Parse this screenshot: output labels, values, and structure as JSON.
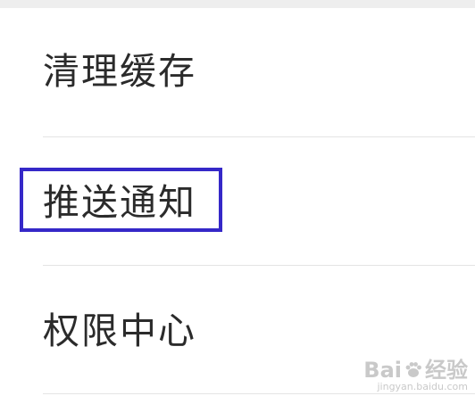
{
  "settings": {
    "items": [
      {
        "label": "清理缓存"
      },
      {
        "label": "推送通知"
      },
      {
        "label": "权限中心"
      }
    ]
  },
  "highlight": {
    "target": "推送通知",
    "color": "#3528c8"
  },
  "watermark": {
    "brand_left": "Bai",
    "brand_right": "经验",
    "url": "jingyan.baidu.com"
  }
}
